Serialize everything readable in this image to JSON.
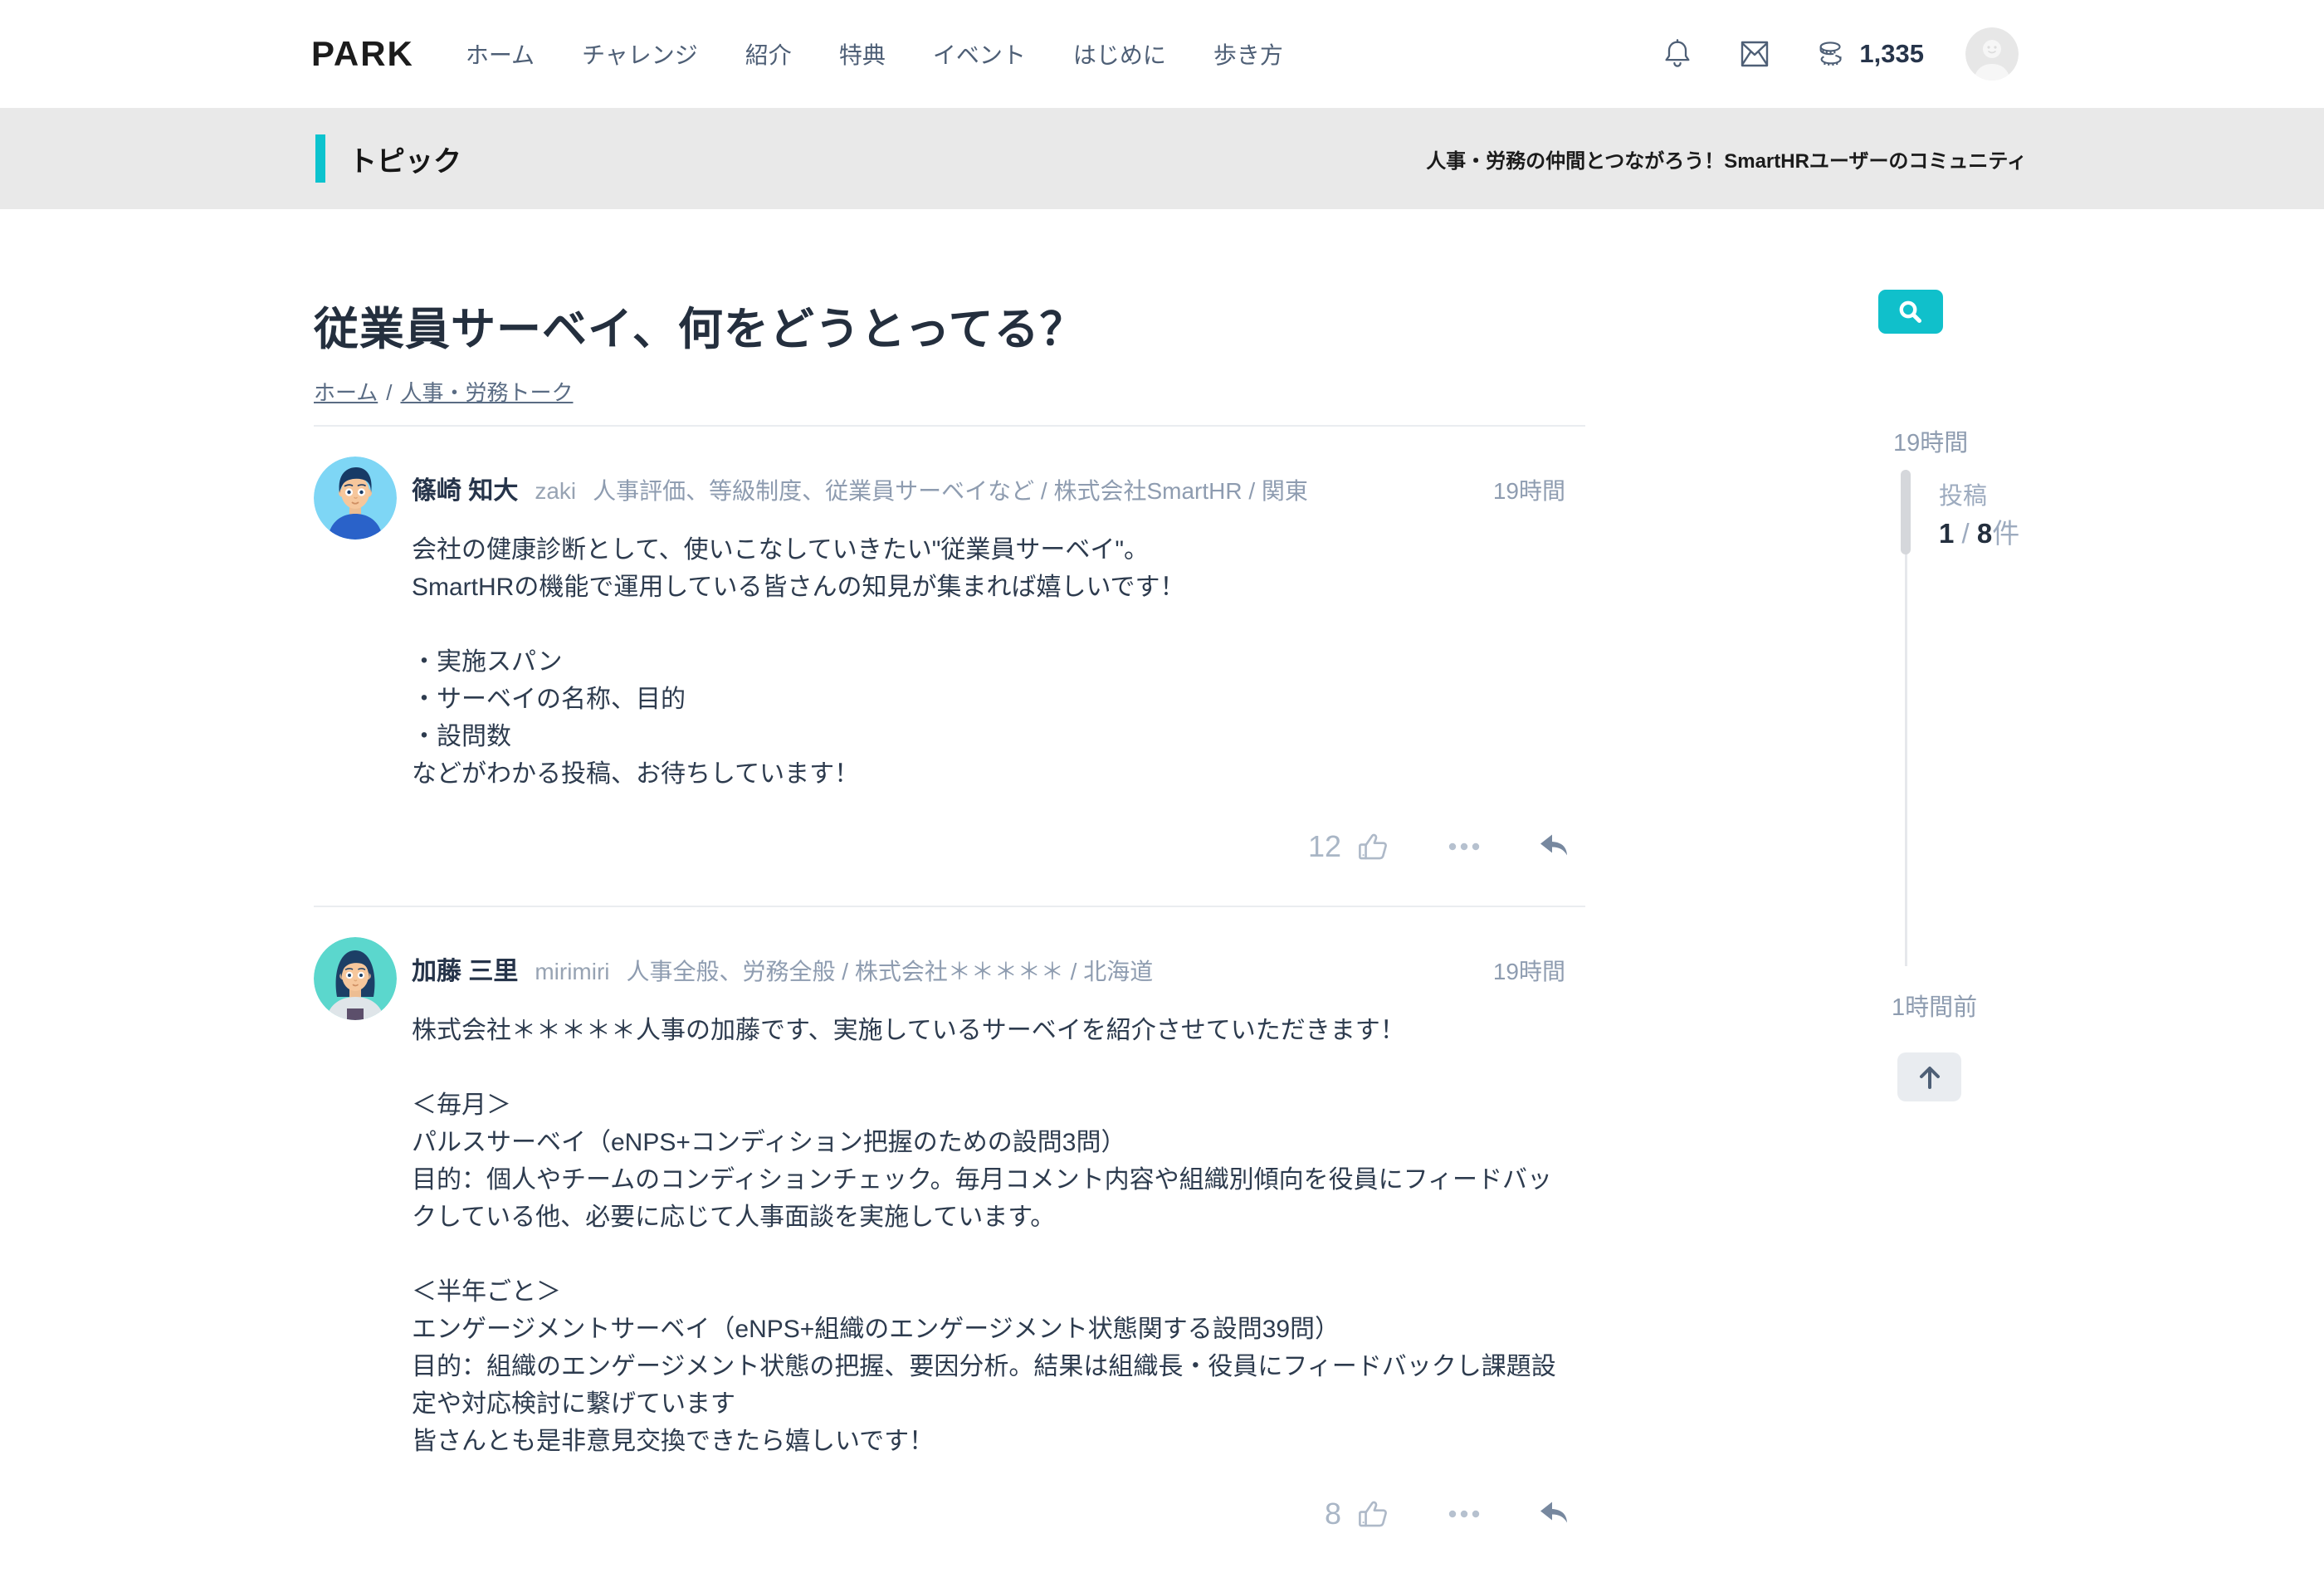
{
  "header": {
    "logo": "PARK",
    "nav": {
      "home": "ホーム",
      "challenge": "チャレンジ",
      "intro": "紹介",
      "benefits": "特典",
      "events": "イベント",
      "getting_started": "はじめに",
      "guide": "歩き方"
    },
    "coin_count": "1,335",
    "icons": {
      "bell": "notification-bell",
      "envelope": "messages",
      "coins": "points",
      "avatar": "user-avatar-placeholder"
    }
  },
  "topic_bar": {
    "title": "トピック",
    "tagline": "人事・労務の仲間とつながろう！SmartHRユーザーのコミュニティ"
  },
  "page": {
    "title": "従業員サーベイ、何をどうとってる？",
    "breadcrumb_home": "ホーム",
    "breadcrumb_sep": "/",
    "breadcrumb_category": "人事・労務トーク"
  },
  "posts": [
    {
      "author": "篠崎 知大",
      "handle": "zaki",
      "meta": "人事評価、等級制度、従業員サーベイなど / 株式会社SmartHR / 関東",
      "time": "19時間",
      "body": "会社の健康診断として、使いこなしていきたい\"従業員サーベイ\"。\nSmartHRの機能で運用している皆さんの知見が集まれば嬉しいです！\n\n・実施スパン\n・サーベイの名称、目的\n・設問数\nなどがわかる投稿、お待ちしています！",
      "likes": "12"
    },
    {
      "author": "加藤 三里",
      "handle": "mirimiri",
      "meta": "人事全般、労務全般 / 株式会社＊＊＊＊＊ / 北海道",
      "time": "19時間",
      "body": "株式会社＊＊＊＊＊人事の加藤です、実施しているサーベイを紹介させていただきます！\n\n＜毎月＞\nパルスサーベイ（eNPS+コンディション把握のための設問3問）\n目的：個人やチームのコンディションチェック。毎月コメント内容や組織別傾向を役員にフィードバックしている他、必要に応じて人事面談を実施しています。\n\n＜半年ごと＞\nエンゲージメントサーベイ（eNPS+組織のエンゲージメント状態関する設問39問）\n目的：組織のエンゲージメント状態の把握、要因分析。結果は組織長・役員にフィードバックし課題設定や対応検討に繋げています\n皆さんとも是非意見交換できたら嬉しいです！",
      "likes": "8"
    }
  ],
  "sidebar": {
    "top_time": "19時間",
    "posts_label": "投稿",
    "current": "1",
    "separator": " / ",
    "total": "8",
    "unit": "件",
    "bottom_time": "1時間前"
  }
}
